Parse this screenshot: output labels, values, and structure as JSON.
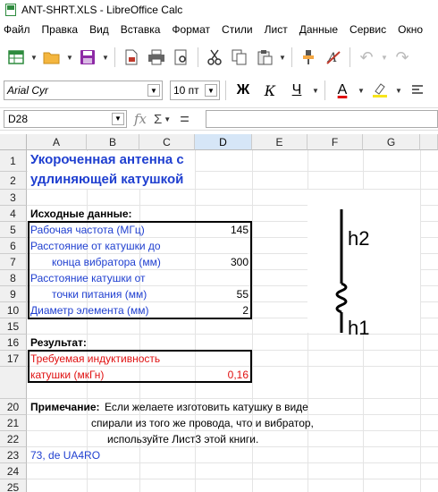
{
  "window": {
    "title": "ANT-SHRT.XLS - LibreOffice Calc"
  },
  "menu": [
    "Файл",
    "Правка",
    "Вид",
    "Вставка",
    "Формат",
    "Стили",
    "Лист",
    "Данные",
    "Сервис",
    "Окно"
  ],
  "toolbar": {
    "icons": [
      "new-icon",
      "open-icon",
      "save-icon",
      "export-pdf-icon",
      "print-icon",
      "cut-icon",
      "copy-icon",
      "paste-icon",
      "clone-format-icon",
      "clear-format-icon",
      "undo-icon"
    ]
  },
  "format_bar": {
    "font_name": "Arial Cyr",
    "font_size": "10 пт",
    "bold_label": "Ж",
    "italic_label": "К",
    "underline_label": "Ч",
    "font_color_label": "A"
  },
  "formula_bar": {
    "cell_ref": "D28",
    "fx": "fx",
    "sum": "Σ",
    "equals": "="
  },
  "columns": [
    "A",
    "B",
    "C",
    "D",
    "E",
    "F",
    "G"
  ],
  "selected_column": "D",
  "rows": [
    "1",
    "2",
    "3",
    "4",
    "5",
    "6",
    "7",
    "8",
    "9",
    "10",
    "15",
    "16",
    "17",
    "20",
    "21",
    "22",
    "23",
    "24",
    "25"
  ],
  "cells": {
    "r1_title": "Укороченная антенна с",
    "r2_title": "удлиняющей катушкой",
    "r4": "Исходные данные:",
    "r5_label": "Рабочая частота (МГц)",
    "r5_value": "145",
    "r6_label": "Расстояние от катушки до",
    "r7_label": "конца  вибратора  (мм)",
    "r7_value": "300",
    "r8_label": "Расстояние катушки от",
    "r9_label": "точки     питания  (мм)",
    "r9_value": "55",
    "r10_label": "Диаметр элемента  (мм)",
    "r10_value": "2",
    "r15": "Результат:",
    "r16_label": "Требуемая индуктивность",
    "r17_label": "катушки (мкГн)",
    "r17_value": "0,16",
    "r20_bold": "Примечание:",
    "r20_text": "Если желаете изготовить катушку в виде",
    "r21": "спирали из того же провода, что и вибратор,",
    "r22": "используйте Лист3 этой книги.",
    "r23": "73, de UA4RO"
  },
  "diagram": {
    "label_h2": "h2",
    "label_h1": "h1"
  },
  "colors": {
    "blue_text": "#1f3fd0",
    "red_text": "#e01010",
    "selection": "#2a6cc4"
  }
}
